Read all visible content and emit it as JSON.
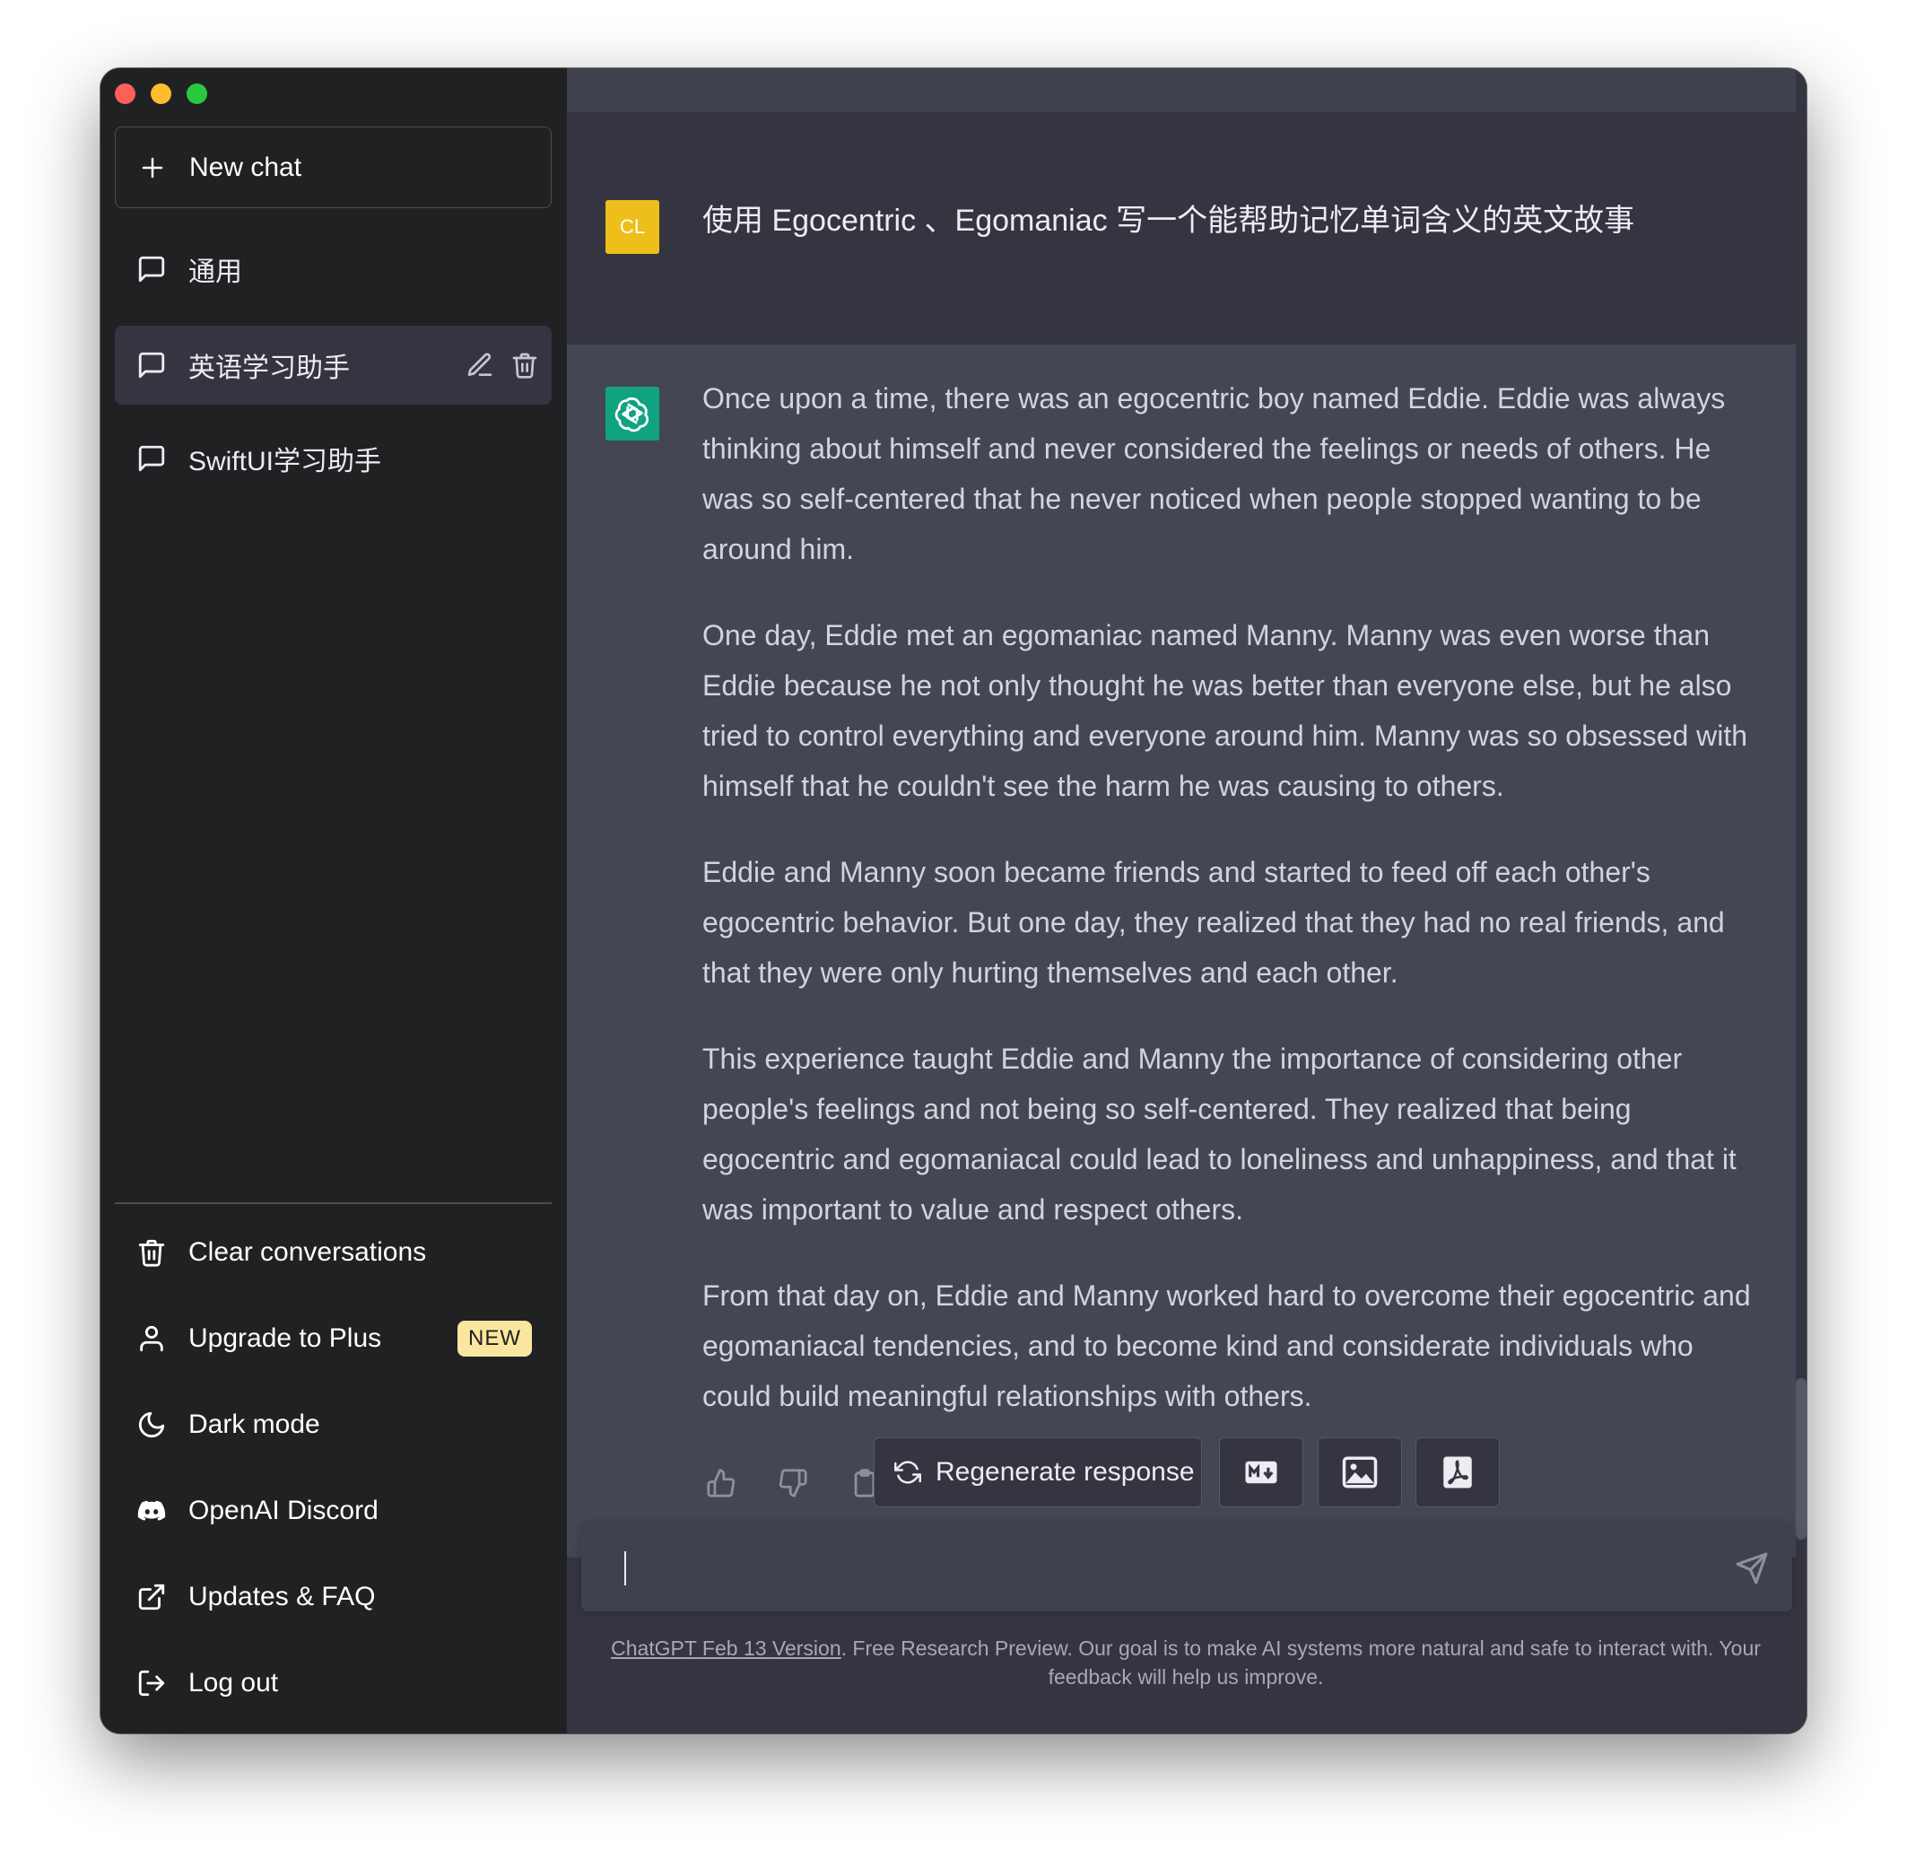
{
  "window": {
    "title": ""
  },
  "sidebar": {
    "new_chat_label": "New chat",
    "conversations": [
      {
        "label": "通用",
        "icon": "chat-bubble-icon"
      },
      {
        "label": "英语学习助手",
        "icon": "chat-bubble-icon",
        "active": true
      },
      {
        "label": "SwiftUI学习助手",
        "icon": "chat-bubble-icon"
      }
    ],
    "menu": [
      {
        "label": "Clear conversations",
        "icon": "trash-icon"
      },
      {
        "label": "Upgrade to Plus",
        "icon": "user-icon",
        "badge": "NEW"
      },
      {
        "label": "Dark mode",
        "icon": "moon-icon"
      },
      {
        "label": "OpenAI Discord",
        "icon": "discord-icon"
      },
      {
        "label": "Updates & FAQ",
        "icon": "external-link-icon"
      },
      {
        "label": "Log out",
        "icon": "logout-icon"
      }
    ]
  },
  "chat": {
    "user": {
      "avatar_initials": "CL",
      "message": "使用 Egocentric 、Egomaniac 写一个能帮助记忆单词含义的英文故事"
    },
    "assistant": {
      "paragraphs": [
        "Once upon a time, there was an egocentric boy named Eddie. Eddie was always thinking about himself and never considered the feelings or needs of others. He was so self-centered that he never noticed when people stopped wanting to be around him.",
        "One day, Eddie met an egomaniac named Manny. Manny was even worse than Eddie because he not only thought he was better than everyone else, but he also tried to control everything and everyone around him. Manny was so obsessed with himself that he couldn't see the harm he was causing to others.",
        "Eddie and Manny soon became friends and started to feed off each other's egocentric behavior. But one day, they realized that they had no real friends, and that they were only hurting themselves and each other.",
        "This experience taught Eddie and Manny the importance of considering other people's feelings and not being so self-centered. They realized that being egocentric and egomaniacal could lead to loneliness and unhappiness, and that it was important to value and respect others.",
        "From that day on, Eddie and Manny worked hard to overcome their egocentric and egomaniacal tendencies, and to become kind and considerate individuals who could build meaningful relationships with others."
      ]
    },
    "regenerate_label": "Regenerate response",
    "export_buttons": [
      "markdown-icon",
      "image-icon",
      "pdf-icon"
    ]
  },
  "input": {
    "value": "",
    "placeholder": ""
  },
  "footer": {
    "link_text": "ChatGPT Feb 13 Version",
    "text": ". Free Research Preview. Our goal is to make AI systems more natural and safe to interact with. Your feedback will help us improve."
  },
  "colors": {
    "sidebar_bg": "#202123",
    "main_bg": "#343541",
    "assistant_bg": "#444654",
    "user_avatar": "#eebe1a",
    "assistant_avatar": "#10a37f",
    "badge_bg": "#fae69e"
  }
}
